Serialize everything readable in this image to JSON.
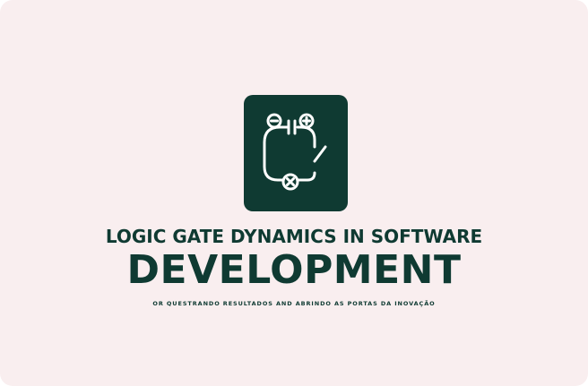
{
  "heading": {
    "line1": "LOGIC GATE DYNAMICS IN SOFTWARE",
    "line2": "DEVELOPMENT"
  },
  "tagline": "OR QUESTRANDO RESULTADOS AND ABRINDO AS PORTAS DA INOVAÇÃO",
  "logo": {
    "icon": "circuit-switch-icon"
  },
  "colors": {
    "background": "#f9eeef",
    "brand": "#0f3a32",
    "icon_stroke": "#ffffff"
  }
}
